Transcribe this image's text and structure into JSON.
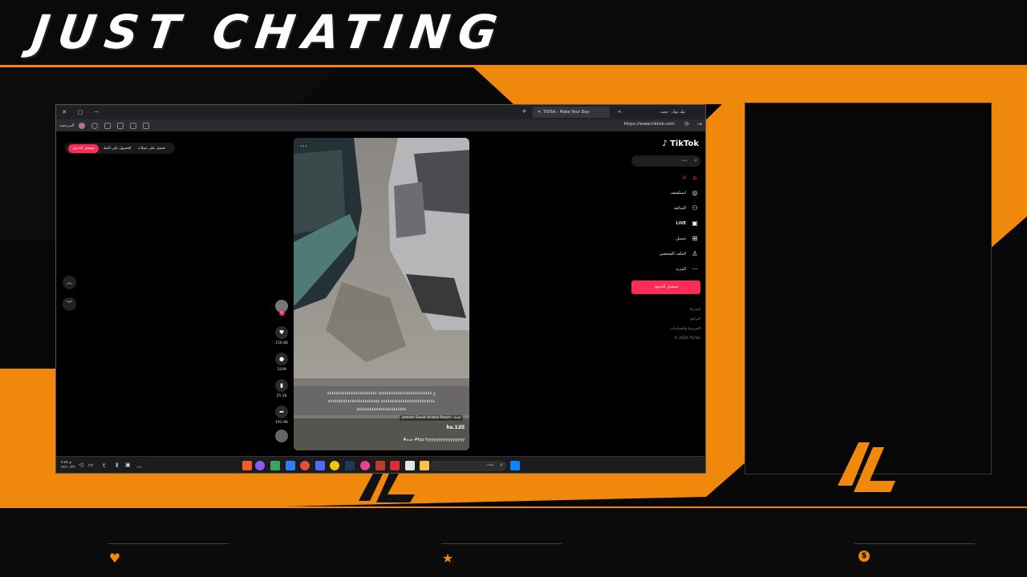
{
  "overlay": {
    "title": "JUST CHATING",
    "accent_color": "#f0890b",
    "footer_icons": [
      "heart-icon",
      "star-icon",
      "dollar-coin-icon"
    ],
    "coin_glyph": "$"
  },
  "browser": {
    "tabs": [
      {
        "label": "تيك توك - بحث",
        "active": false
      },
      {
        "label": "TikTok - Make Your Day",
        "active": true
      }
    ],
    "url": "https://www.tiktok.com",
    "sidebar_label": "المرجعية"
  },
  "tiktok": {
    "logo": "TikTok",
    "search_placeholder": "بحث",
    "top_bar": {
      "login": "تسجيل الدخول",
      "get_app": "الحصول على التطـ",
      "coins": "تحصل على عملات"
    },
    "nav": [
      {
        "label": "لك",
        "icon": "home-icon",
        "active": true
      },
      {
        "label": "استكشف",
        "icon": "compass-icon",
        "active": false
      },
      {
        "label": "المتابَعة",
        "icon": "following-icon",
        "active": false
      },
      {
        "label": "LIVE",
        "icon": "live-icon",
        "active": false
      },
      {
        "label": "تحميل",
        "icon": "upload-icon",
        "active": false
      },
      {
        "label": "الملف الشخصي",
        "icon": "profile-icon",
        "active": false
      },
      {
        "label": "المزيد",
        "icon": "more-icon",
        "active": false
      }
    ],
    "login_button": "تسجيل الدخول",
    "footer_links": [
      "الشركة",
      "البرامج",
      "الشروط والسياسات",
      "© 2026 TikTok"
    ],
    "video": {
      "caption_line1": "ع ٤٤٤٤٤٤٤٤٤٤٤٤٤٤٤٤٤٤٤٤٤٤٤٤٤ ٤٤٤٤٤٤٤٤٤٤٤٤٤٤٤٤٤٤٤٤٤٤٤",
      "caption_line2": "٤٤٤٤٤٤٤٤٤٤٤٤٤٤٤٤٤٤٤٤٤٤٤٤٤ ٤٤٤٤٤٤٤٤٤٤٤٤٤٤٤٤٤٤٤٤٤٤٤٤",
      "caption_line3": "٤٤٤٤٤٤٤٤٤٤٤٤٤٤٤٤٤٤٤٤٤٤٤",
      "location": "Jeddah Saudi Arabia Reach - جدة",
      "username": "hs.12li",
      "description": "#جده #fyp fyyyyyyyyyyyyyyyy",
      "likes": "150.8K",
      "comments": "3199",
      "saves": "25.1K",
      "shares": "193.9K"
    }
  },
  "taskbar": {
    "search_placeholder": "بحث",
    "time": "م ٥:٥٥",
    "date": "٢٧/١٠/٢٩"
  }
}
